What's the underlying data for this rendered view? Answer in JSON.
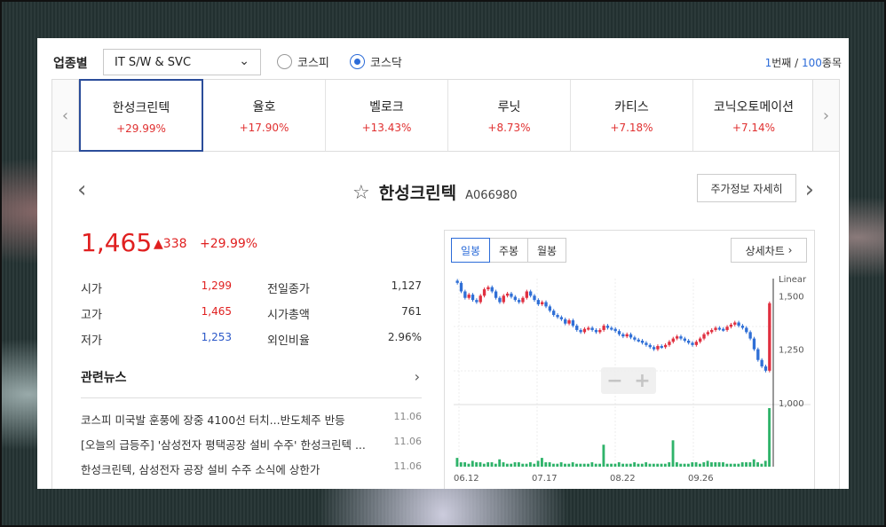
{
  "filter": {
    "label": "업종별",
    "sector": "IT S/W & SVC",
    "radios": [
      {
        "label": "코스피",
        "checked": false
      },
      {
        "label": "코스닥",
        "checked": true
      }
    ],
    "pager": {
      "current": "1",
      "unit1": "번째 / ",
      "total": "100",
      "unit2": "종목"
    }
  },
  "stocks": [
    {
      "name": "한성크린텍",
      "change": "+29.99%"
    },
    {
      "name": "율호",
      "change": "+17.90%"
    },
    {
      "name": "벨로크",
      "change": "+13.43%"
    },
    {
      "name": "루닛",
      "change": "+8.73%"
    },
    {
      "name": "카티스",
      "change": "+7.18%"
    },
    {
      "name": "코닉오토메이션",
      "change": "+7.14%"
    }
  ],
  "detail": {
    "name": "한성크린텍",
    "code": "A066980",
    "detail_button": "주가정보 자세히",
    "price": "1,465",
    "change": "338",
    "change_pct": "+29.99%",
    "stats": [
      {
        "k1": "시가",
        "v1": "1,299",
        "k2": "전일종가",
        "v2": "1,127"
      },
      {
        "k1": "고가",
        "v1": "1,465",
        "k2": "시가총액",
        "v2": "761"
      },
      {
        "k1": "저가",
        "v1": "1,253",
        "k2": "외인비율",
        "v2": "2.96%"
      }
    ],
    "news_title": "관련뉴스",
    "news": [
      {
        "title": "코스피 미국발 훈풍에 장중 4100선 터치...반도체주 반등",
        "date": "11.06"
      },
      {
        "title": "[오늘의 급등주] '삼성전자 평택공장 설비 수주' 한성크린텍 ...",
        "date": "11.06"
      },
      {
        "title": "한성크린텍, 삼성전자 공장 설비 수주 소식에 상한가",
        "date": "11.06"
      }
    ]
  },
  "chart": {
    "tabs": [
      "일봉",
      "주봉",
      "월봉"
    ],
    "active_tab": 0,
    "detail_button": "상세차트",
    "scale_label": "Linear",
    "colors": {
      "up": "#e03040",
      "down": "#2f6fd6",
      "volume": "#2fb36a"
    }
  },
  "chart_data": {
    "type": "candlestick",
    "y_ticks": [
      "1,500",
      "1,250",
      "1,000"
    ],
    "ylim": [
      1000,
      1580
    ],
    "x_ticks": [
      "06.12",
      "07.17",
      "08.22",
      "09.26"
    ],
    "close_series": [
      1560,
      1520,
      1490,
      1505,
      1480,
      1470,
      1500,
      1530,
      1540,
      1520,
      1490,
      1470,
      1500,
      1510,
      1495,
      1480,
      1470,
      1490,
      1520,
      1500,
      1480,
      1460,
      1470,
      1450,
      1430,
      1410,
      1400,
      1390,
      1370,
      1385,
      1360,
      1340,
      1330,
      1345,
      1350,
      1340,
      1330,
      1340,
      1360,
      1350,
      1345,
      1335,
      1320,
      1310,
      1320,
      1305,
      1295,
      1290,
      1280,
      1270,
      1260,
      1250,
      1265,
      1260,
      1270,
      1285,
      1300,
      1310,
      1300,
      1290,
      1280,
      1270,
      1285,
      1300,
      1320,
      1330,
      1340,
      1350,
      1345,
      1340,
      1355,
      1365,
      1375,
      1360,
      1350,
      1330,
      1300,
      1250,
      1200,
      1170,
      1150,
      1465
    ],
    "volume_series": [
      6,
      3,
      3,
      2,
      4,
      3,
      3,
      2,
      3,
      3,
      2,
      5,
      3,
      2,
      2,
      3,
      3,
      2,
      2,
      3,
      2,
      4,
      6,
      3,
      3,
      2,
      2,
      3,
      2,
      2,
      3,
      2,
      2,
      2,
      2,
      3,
      2,
      2,
      15,
      2,
      2,
      2,
      3,
      2,
      2,
      2,
      3,
      2,
      2,
      3,
      2,
      2,
      2,
      2,
      2,
      3,
      18,
      3,
      2,
      2,
      2,
      3,
      3,
      2,
      3,
      4,
      3,
      3,
      3,
      3,
      2,
      2,
      2,
      2,
      3,
      3,
      3,
      5,
      3,
      2,
      4,
      40
    ]
  }
}
